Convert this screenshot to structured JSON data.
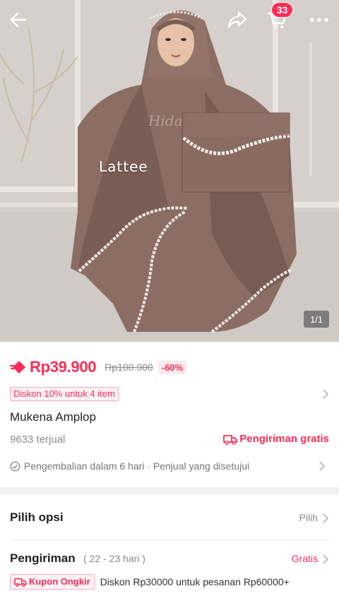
{
  "header": {
    "cart_count": "33",
    "icons": [
      "back-arrow-icon",
      "share-icon",
      "cart-icon",
      "more-icon"
    ]
  },
  "gallery": {
    "watermark_text": "Lattee",
    "page_indicator": "1/1"
  },
  "product": {
    "price": "Rp39.900",
    "original_price": "Rp100.000",
    "discount": "-60%",
    "promo": "Diskon 10% untuk 4 item",
    "title": "Mukena Amplop",
    "sold": "9633 terjual",
    "shipping_badge": "Pengiriman gratis",
    "return_policy": "Pengembalian dalam 6 hari · Penjual yang disetujui"
  },
  "options": {
    "label": "Pilih opsi",
    "action": "Pilih"
  },
  "shipping": {
    "label": "Pengiriman",
    "days": "( 22 - 23 hari )",
    "cost": "Gratis",
    "coupon_label": "Kupon Ongkir",
    "coupon_text": "Diskon Rp30000 untuk pesanan Rp60000+"
  },
  "colors": {
    "accent": "#fe2c55",
    "muted": "#8a8a8a",
    "divider": "#f1f1f2"
  }
}
